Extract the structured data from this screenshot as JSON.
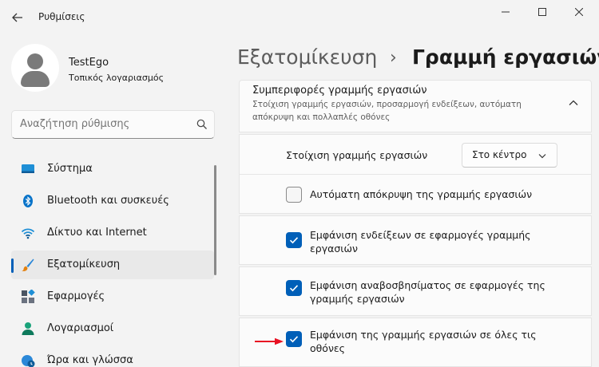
{
  "window": {
    "title": "Ρυθμίσεις",
    "back_icon": "back-arrow-icon",
    "controls": [
      "minimize-icon",
      "maximize-icon",
      "close-icon"
    ]
  },
  "user": {
    "name": "TestEgo",
    "account_type": "Τοπικός λογαριασμός"
  },
  "search": {
    "placeholder": "Αναζήτηση ρύθμισης"
  },
  "sidebar": {
    "items": [
      {
        "label": "Σύστημα",
        "icon": "system-display-icon"
      },
      {
        "label": "Bluetooth και συσκευές",
        "icon": "bluetooth-icon"
      },
      {
        "label": "Δίκτυο και Internet",
        "icon": "wifi-icon"
      },
      {
        "label": "Εξατομίκευση",
        "icon": "brush-icon",
        "selected": true
      },
      {
        "label": "Εφαρμογές",
        "icon": "apps-icon"
      },
      {
        "label": "Λογαριασμοί",
        "icon": "account-icon"
      },
      {
        "label": "Ώρα και γλώσσα",
        "icon": "globe-clock-icon"
      }
    ]
  },
  "breadcrumb": {
    "parent": "Εξατομίκευση",
    "separator": "›",
    "current": "Γραμμή εργασιών"
  },
  "section": {
    "title": "Συμπεριφορές γραμμής εργασιών",
    "description": "Στοίχιση γραμμής εργασιών, προσαρμογή ενδείξεων, αυτόματη απόκρυψη και πολλαπλές οθόνες",
    "expanded": true
  },
  "settings": {
    "alignment": {
      "label": "Στοίχιση γραμμής εργασιών",
      "value": "Στο κέντρο"
    },
    "options": [
      {
        "label": "Αυτόματη απόκρυψη της γραμμής εργασιών",
        "checked": false
      },
      {
        "label": "Εμφάνιση ενδείξεων σε εφαρμογές γραμμής εργασιών",
        "checked": true
      },
      {
        "label": "Εμφάνιση αναβοσβησίματος σε εφαρμογές της γραμμής εργασιών",
        "checked": true
      },
      {
        "label": "Εμφάνιση της γραμμής εργασιών σε όλες τις οθόνες",
        "checked": true
      }
    ]
  },
  "colors": {
    "accent": "#005fb8",
    "annotation_arrow": "#e81123"
  }
}
